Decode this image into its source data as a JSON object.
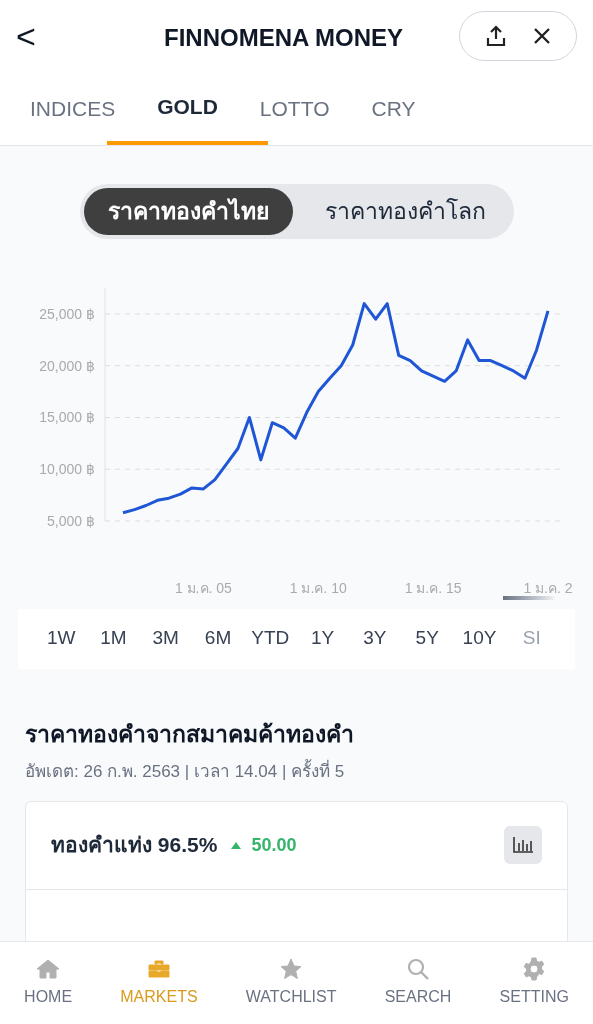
{
  "header": {
    "back": "<",
    "title": "FINNOMENA MONEY"
  },
  "tabs": [
    {
      "label": "INDICES",
      "selected": false
    },
    {
      "label": "GOLD",
      "selected": true
    },
    {
      "label": "LOTTO",
      "selected": false
    },
    {
      "label": "CRY",
      "selected": false
    }
  ],
  "segments": [
    {
      "label": "ราคาทองคำไทย",
      "selected": true
    },
    {
      "label": "ราคาทองคำโลก",
      "selected": false
    }
  ],
  "chart_data": {
    "type": "line",
    "grid": true,
    "ylim": [
      5000,
      27500
    ],
    "categories": [
      null,
      null,
      null,
      null,
      null,
      null,
      null,
      "1 ม.ค. 05",
      null,
      null,
      null,
      null,
      null,
      null,
      null,
      null,
      null,
      "1 ม.ค. 10",
      null,
      null,
      null,
      null,
      null,
      null,
      null,
      null,
      null,
      "1 ม.ค. 15",
      null,
      null,
      null,
      null,
      null,
      null,
      null,
      null,
      null,
      "1 ม.ค. 2"
    ],
    "yticks": [
      {
        "value": 5000,
        "label": "5,000 ฿"
      },
      {
        "value": 10000,
        "label": "10,000 ฿"
      },
      {
        "value": 15000,
        "label": "15,000 ฿"
      },
      {
        "value": 20000,
        "label": "20,000 ฿"
      },
      {
        "value": 25000,
        "label": "25,000 ฿"
      }
    ],
    "series": [
      {
        "color": "#1f56d6",
        "values": [
          5800,
          6100,
          6500,
          7000,
          7200,
          7600,
          8200,
          8100,
          9000,
          10500,
          12000,
          15000,
          10900,
          14500,
          14000,
          13000,
          15500,
          17500,
          18800,
          20000,
          22000,
          26000,
          24500,
          26000,
          21000,
          20500,
          19500,
          19000,
          18500,
          19500,
          22500,
          20500,
          20500,
          20000,
          19500,
          18800,
          21500,
          25300
        ]
      }
    ]
  },
  "ranges": [
    {
      "label": "1W",
      "selected": false
    },
    {
      "label": "1M",
      "selected": false
    },
    {
      "label": "3M",
      "selected": false
    },
    {
      "label": "6M",
      "selected": false
    },
    {
      "label": "YTD",
      "selected": false
    },
    {
      "label": "1Y",
      "selected": false
    },
    {
      "label": "3Y",
      "selected": false
    },
    {
      "label": "5Y",
      "selected": false
    },
    {
      "label": "10Y",
      "selected": false
    },
    {
      "label": "SI",
      "selected": true
    }
  ],
  "section": {
    "title": "ราคาทองคำจากสมาคมค้าทองคำ",
    "subtitle": "อัพเดต: 26 ก.พ. 2563 | เวลา 14.04 | ครั้งที่ 5"
  },
  "card": {
    "title": "ทองคำแท่ง 96.5%",
    "change": "50.00",
    "rising": true
  },
  "nav": [
    {
      "label": "HOME",
      "selected": false
    },
    {
      "label": "MARKETS",
      "selected": true
    },
    {
      "label": "WATCHLIST",
      "selected": false
    },
    {
      "label": "SEARCH",
      "selected": false
    },
    {
      "label": "SETTING",
      "selected": false
    }
  ]
}
